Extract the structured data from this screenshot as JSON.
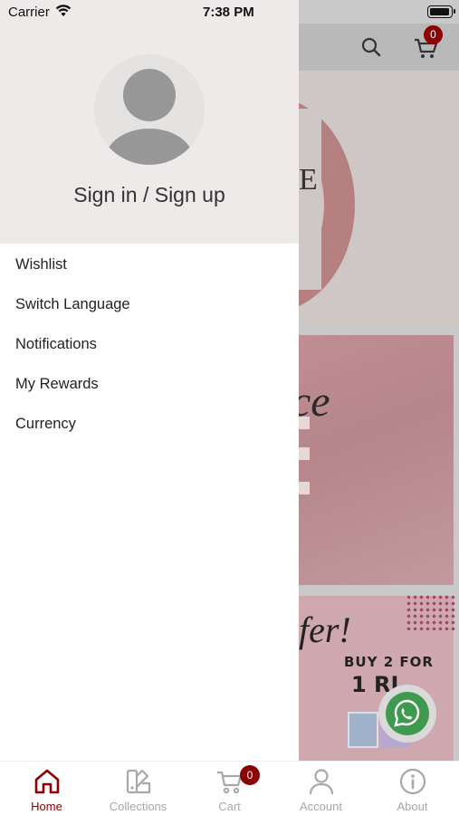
{
  "status_bar": {
    "carrier": "Carrier",
    "time": "7:38 PM"
  },
  "background": {
    "cart_count": "0",
    "banner1_text": "E",
    "banner2_text": "ce",
    "banner3_script": "fer!",
    "banner3_offer_line1": "BUY 2 FOR",
    "banner3_offer_line2": "1 RI"
  },
  "drawer": {
    "sign_in_label": "Sign in / Sign up",
    "menu_items": [
      {
        "label": "Wishlist"
      },
      {
        "label": "Switch Language"
      },
      {
        "label": "Notifications"
      },
      {
        "label": "My Rewards"
      },
      {
        "label": "Currency"
      }
    ]
  },
  "tabbar": {
    "tabs": [
      {
        "label": "Home",
        "icon": "home-icon",
        "active": true
      },
      {
        "label": "Collections",
        "icon": "collections-icon",
        "active": false
      },
      {
        "label": "Cart",
        "icon": "cart-icon",
        "active": false,
        "badge": "0"
      },
      {
        "label": "Account",
        "icon": "account-icon",
        "active": false
      },
      {
        "label": "About",
        "icon": "info-icon",
        "active": false
      }
    ]
  },
  "colors": {
    "accent": "#8b0000",
    "drawer_header": "#eeeaea",
    "inactive_tab": "#a8a8a8",
    "whatsapp": "#3f9a4f"
  }
}
